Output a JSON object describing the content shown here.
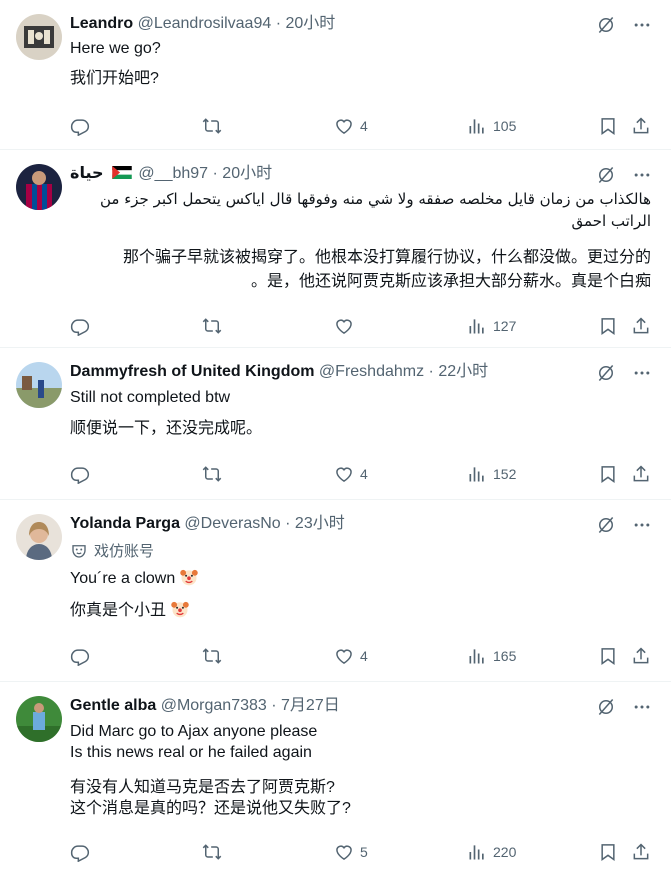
{
  "tweets": [
    {
      "name": "Leandro",
      "handle": "@Leandrosilvaa94",
      "time": "· 20小时",
      "lines": [
        "Here we go?",
        "我们开始吧?"
      ],
      "replies": "",
      "retweets": "",
      "likes": "4",
      "views": "105"
    },
    {
      "name": "حياة",
      "handle": "@__bh97",
      "time": "· 20小时",
      "arabic": "هالكذاب من زمان قايل مخلصه صفقه ولا شي منه وفوقها قال اياكس يتحمل اكبر جزء من الراتب احمق",
      "translation_1": "那个骗子早就该被揭穿了。他根本没打算履行协议，什么都没做。更过分的",
      "translation_2": "。是，他还说阿贾克斯应该承担大部分薪水。真是个白痴",
      "replies": "",
      "retweets": "",
      "likes": "",
      "views": "127"
    },
    {
      "name": "Dammyfresh of United Kingdom",
      "handle": "@Freshdahmz",
      "time": "· 22小时",
      "lines": [
        "Still not completed btw",
        "顺便说一下，还没完成呢。"
      ],
      "replies": "",
      "retweets": "",
      "likes": "4",
      "views": "152"
    },
    {
      "name": "Yolanda Parga",
      "handle": "@DeverasNo",
      "time": "· 23小时",
      "parody_label": "戏仿账号",
      "lines": [
        "You´re a clown",
        "你真是个小丑"
      ],
      "replies": "",
      "retweets": "",
      "likes": "4",
      "views": "165"
    },
    {
      "name": "Gentle alba",
      "handle": "@Morgan7383",
      "time": "· 7月27日",
      "lines": [
        "Did Marc go to Ajax anyone please",
        "Is this news real or he failed again",
        "有没有人知道马克是否去了阿贾克斯?",
        "这个消息是真的吗？还是说他又失败了?"
      ],
      "replies": "",
      "retweets": "",
      "likes": "5",
      "views": "220"
    }
  ],
  "icons": {
    "reply": "reply-icon",
    "retweet": "retweet-icon",
    "like": "heart-icon",
    "views": "views-chart-icon",
    "bookmark": "bookmark-icon",
    "share": "share-icon",
    "grok": "grok-icon",
    "more": "more-icon",
    "parody": "parody-mask-icon",
    "clown": "clown-emoji-icon"
  },
  "colors": {
    "text": "#0f1419",
    "secondary": "#536471",
    "divider": "#eff3f4"
  }
}
